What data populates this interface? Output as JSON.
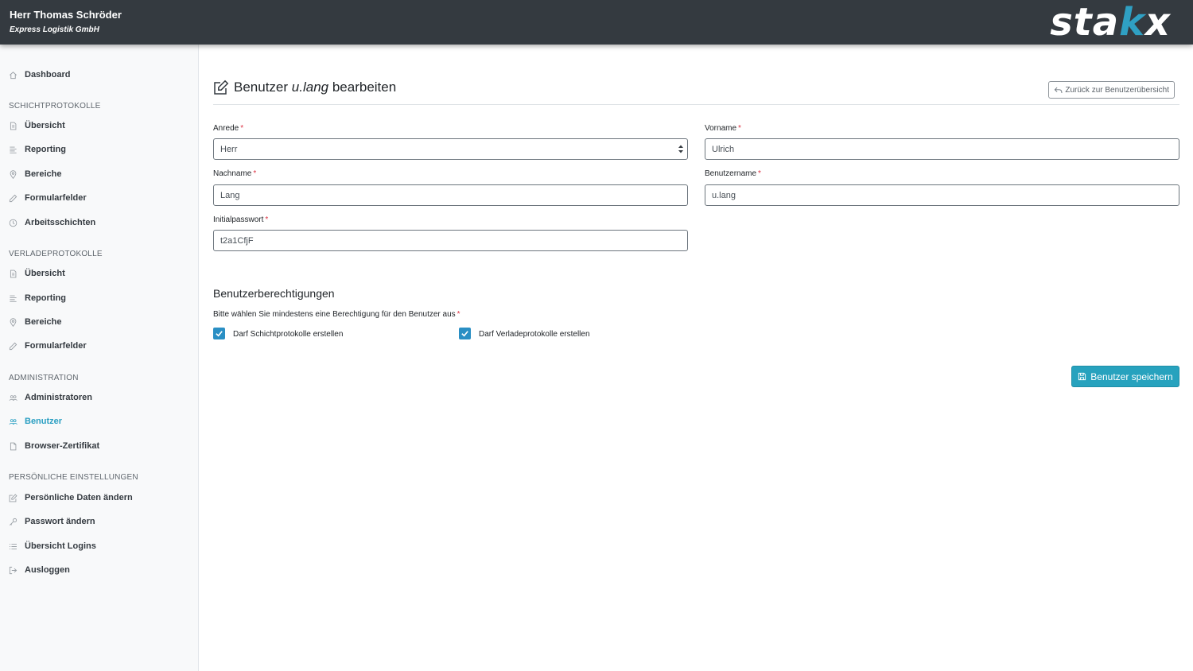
{
  "header": {
    "user_name": "Herr Thomas Schröder",
    "company": "Express Logistik GmbH",
    "logo_prefix": "sta",
    "logo_k": "k",
    "logo_suffix": "x"
  },
  "sidebar": {
    "dashboard": "Dashboard",
    "sections": [
      {
        "heading": "SCHICHTPROTOKOLLE",
        "items": [
          "Übersicht",
          "Reporting",
          "Bereiche",
          "Formularfelder",
          "Arbeitsschichten"
        ]
      },
      {
        "heading": "VERLADEPROTOKOLLE",
        "items": [
          "Übersicht",
          "Reporting",
          "Bereiche",
          "Formularfelder"
        ]
      },
      {
        "heading": "ADMINISTRATION",
        "items": [
          "Administratoren",
          "Benutzer",
          "Browser-Zertifikat"
        ]
      },
      {
        "heading": "PERSÖNLICHE EINSTELLUNGEN",
        "items": [
          "Persönliche Daten ändern",
          "Passwort ändern",
          "Übersicht Logins",
          "Ausloggen"
        ]
      }
    ],
    "active_item": "Benutzer"
  },
  "main": {
    "title_prefix": "Benutzer",
    "title_user": "u.lang",
    "title_suffix": "bearbeiten",
    "back_button": "Zurück zur Benutzerübersicht",
    "form": {
      "anrede": {
        "label": "Anrede",
        "value": "Herr"
      },
      "vorname": {
        "label": "Vorname",
        "value": "Ulrich"
      },
      "nachname": {
        "label": "Nachname",
        "value": "Lang"
      },
      "benutzername": {
        "label": "Benutzername",
        "value": "u.lang"
      },
      "initialpasswort": {
        "label": "Initialpasswort",
        "value": "t2a1CfjF"
      },
      "required_marker": "*"
    },
    "permissions": {
      "title": "Benutzerberechtigungen",
      "hint": "Bitte wählen Sie mindestens eine Berechtigung für den Benutzer aus",
      "options": [
        {
          "label": "Darf Schichtprotokolle erstellen",
          "checked": true
        },
        {
          "label": "Darf Verladeprotokolle erstellen",
          "checked": true
        }
      ]
    },
    "save_button": "Benutzer speichern"
  },
  "colors": {
    "header_bg": "#343a40",
    "accent": "#2a9fc2",
    "save_button": "#27a2be",
    "checkbox": "#2a8fc4",
    "required": "#dc3545"
  }
}
